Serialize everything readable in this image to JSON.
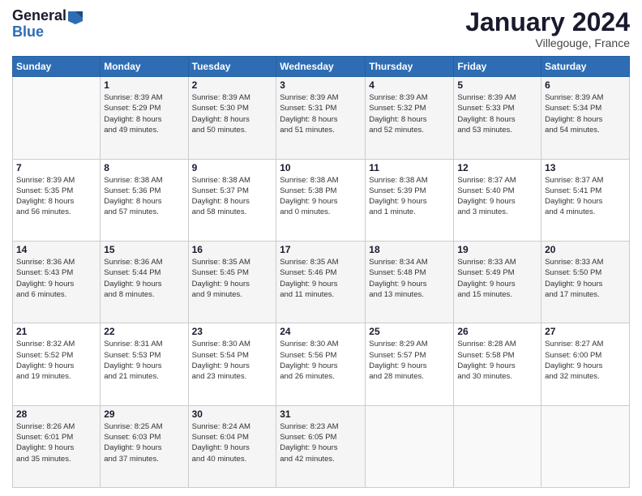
{
  "header": {
    "logo_line1": "General",
    "logo_line2": "Blue",
    "month": "January 2024",
    "location": "Villegouge, France"
  },
  "weekdays": [
    "Sunday",
    "Monday",
    "Tuesday",
    "Wednesday",
    "Thursday",
    "Friday",
    "Saturday"
  ],
  "weeks": [
    [
      {
        "day": "",
        "info": ""
      },
      {
        "day": "1",
        "info": "Sunrise: 8:39 AM\nSunset: 5:29 PM\nDaylight: 8 hours\nand 49 minutes."
      },
      {
        "day": "2",
        "info": "Sunrise: 8:39 AM\nSunset: 5:30 PM\nDaylight: 8 hours\nand 50 minutes."
      },
      {
        "day": "3",
        "info": "Sunrise: 8:39 AM\nSunset: 5:31 PM\nDaylight: 8 hours\nand 51 minutes."
      },
      {
        "day": "4",
        "info": "Sunrise: 8:39 AM\nSunset: 5:32 PM\nDaylight: 8 hours\nand 52 minutes."
      },
      {
        "day": "5",
        "info": "Sunrise: 8:39 AM\nSunset: 5:33 PM\nDaylight: 8 hours\nand 53 minutes."
      },
      {
        "day": "6",
        "info": "Sunrise: 8:39 AM\nSunset: 5:34 PM\nDaylight: 8 hours\nand 54 minutes."
      }
    ],
    [
      {
        "day": "7",
        "info": "Sunrise: 8:39 AM\nSunset: 5:35 PM\nDaylight: 8 hours\nand 56 minutes."
      },
      {
        "day": "8",
        "info": "Sunrise: 8:38 AM\nSunset: 5:36 PM\nDaylight: 8 hours\nand 57 minutes."
      },
      {
        "day": "9",
        "info": "Sunrise: 8:38 AM\nSunset: 5:37 PM\nDaylight: 8 hours\nand 58 minutes."
      },
      {
        "day": "10",
        "info": "Sunrise: 8:38 AM\nSunset: 5:38 PM\nDaylight: 9 hours\nand 0 minutes."
      },
      {
        "day": "11",
        "info": "Sunrise: 8:38 AM\nSunset: 5:39 PM\nDaylight: 9 hours\nand 1 minute."
      },
      {
        "day": "12",
        "info": "Sunrise: 8:37 AM\nSunset: 5:40 PM\nDaylight: 9 hours\nand 3 minutes."
      },
      {
        "day": "13",
        "info": "Sunrise: 8:37 AM\nSunset: 5:41 PM\nDaylight: 9 hours\nand 4 minutes."
      }
    ],
    [
      {
        "day": "14",
        "info": "Sunrise: 8:36 AM\nSunset: 5:43 PM\nDaylight: 9 hours\nand 6 minutes."
      },
      {
        "day": "15",
        "info": "Sunrise: 8:36 AM\nSunset: 5:44 PM\nDaylight: 9 hours\nand 8 minutes."
      },
      {
        "day": "16",
        "info": "Sunrise: 8:35 AM\nSunset: 5:45 PM\nDaylight: 9 hours\nand 9 minutes."
      },
      {
        "day": "17",
        "info": "Sunrise: 8:35 AM\nSunset: 5:46 PM\nDaylight: 9 hours\nand 11 minutes."
      },
      {
        "day": "18",
        "info": "Sunrise: 8:34 AM\nSunset: 5:48 PM\nDaylight: 9 hours\nand 13 minutes."
      },
      {
        "day": "19",
        "info": "Sunrise: 8:33 AM\nSunset: 5:49 PM\nDaylight: 9 hours\nand 15 minutes."
      },
      {
        "day": "20",
        "info": "Sunrise: 8:33 AM\nSunset: 5:50 PM\nDaylight: 9 hours\nand 17 minutes."
      }
    ],
    [
      {
        "day": "21",
        "info": "Sunrise: 8:32 AM\nSunset: 5:52 PM\nDaylight: 9 hours\nand 19 minutes."
      },
      {
        "day": "22",
        "info": "Sunrise: 8:31 AM\nSunset: 5:53 PM\nDaylight: 9 hours\nand 21 minutes."
      },
      {
        "day": "23",
        "info": "Sunrise: 8:30 AM\nSunset: 5:54 PM\nDaylight: 9 hours\nand 23 minutes."
      },
      {
        "day": "24",
        "info": "Sunrise: 8:30 AM\nSunset: 5:56 PM\nDaylight: 9 hours\nand 26 minutes."
      },
      {
        "day": "25",
        "info": "Sunrise: 8:29 AM\nSunset: 5:57 PM\nDaylight: 9 hours\nand 28 minutes."
      },
      {
        "day": "26",
        "info": "Sunrise: 8:28 AM\nSunset: 5:58 PM\nDaylight: 9 hours\nand 30 minutes."
      },
      {
        "day": "27",
        "info": "Sunrise: 8:27 AM\nSunset: 6:00 PM\nDaylight: 9 hours\nand 32 minutes."
      }
    ],
    [
      {
        "day": "28",
        "info": "Sunrise: 8:26 AM\nSunset: 6:01 PM\nDaylight: 9 hours\nand 35 minutes."
      },
      {
        "day": "29",
        "info": "Sunrise: 8:25 AM\nSunset: 6:03 PM\nDaylight: 9 hours\nand 37 minutes."
      },
      {
        "day": "30",
        "info": "Sunrise: 8:24 AM\nSunset: 6:04 PM\nDaylight: 9 hours\nand 40 minutes."
      },
      {
        "day": "31",
        "info": "Sunrise: 8:23 AM\nSunset: 6:05 PM\nDaylight: 9 hours\nand 42 minutes."
      },
      {
        "day": "",
        "info": ""
      },
      {
        "day": "",
        "info": ""
      },
      {
        "day": "",
        "info": ""
      }
    ]
  ]
}
